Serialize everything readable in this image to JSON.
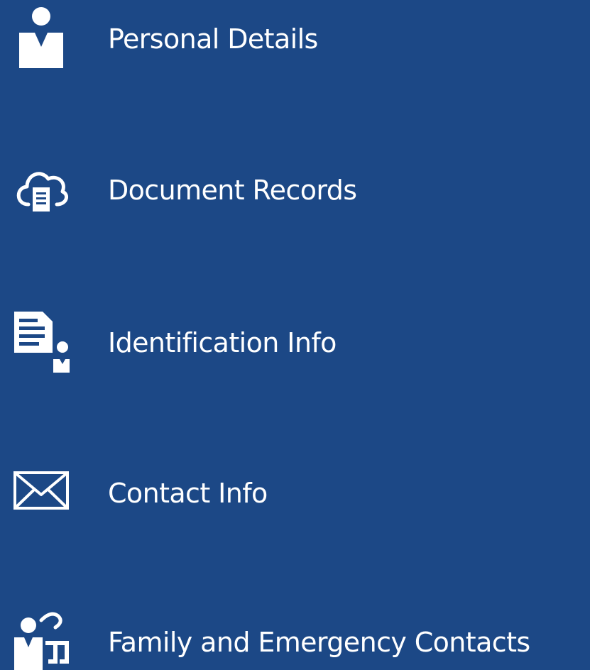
{
  "theme": {
    "background": "#1c4886",
    "foreground": "#ffffff"
  },
  "menu": {
    "items": [
      {
        "label": "Personal Details",
        "icon": "person-icon"
      },
      {
        "label": "Document Records",
        "icon": "cloud-document-icon"
      },
      {
        "label": "Identification Info",
        "icon": "id-card-icon"
      },
      {
        "label": "Contact Info",
        "icon": "envelope-icon"
      },
      {
        "label": "Family and Emergency Contacts",
        "icon": "family-contacts-icon"
      }
    ]
  }
}
